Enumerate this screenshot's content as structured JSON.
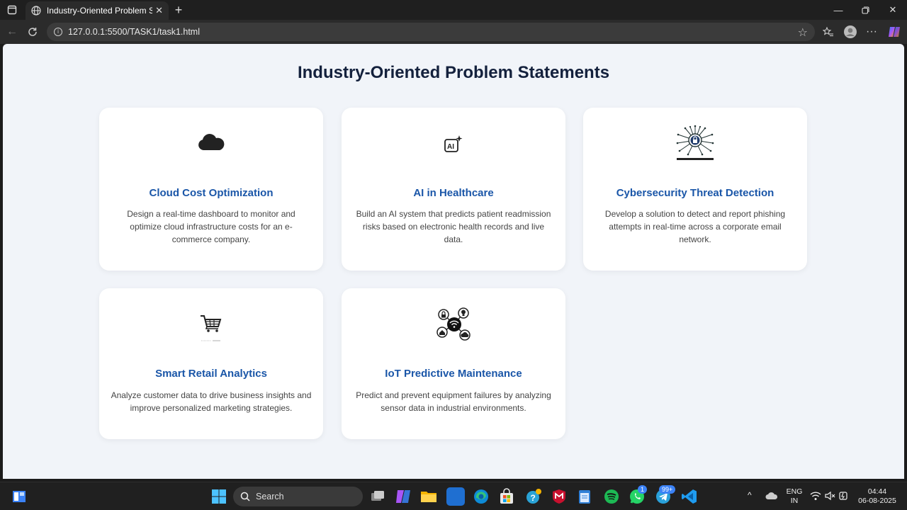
{
  "browser": {
    "tab_title": "Industry-Oriented Problem Staten",
    "url": "127.0.0.1:5500/TASK1/task1.html"
  },
  "page": {
    "title": "Industry-Oriented Problem Statements",
    "cards": [
      {
        "icon": "cloud-icon",
        "title": "Cloud Cost Optimization",
        "description": "Design a real-time dashboard to monitor and optimize cloud infrastructure costs for an e-commerce company."
      },
      {
        "icon": "ai-sparkle-icon",
        "title": "AI in Healthcare",
        "description": "Build an AI system that predicts patient readmission risks based on electronic health records and live data."
      },
      {
        "icon": "circuit-lock-icon",
        "title": "Cybersecurity Threat Detection",
        "description": "Develop a solution to detect and report phishing attempts in real-time across a corporate email network."
      },
      {
        "icon": "shopping-cart-icon",
        "title": "Smart Retail Analytics",
        "description": "Analyze customer data to drive business insights and improve personalized marketing strategies."
      },
      {
        "icon": "iot-network-icon",
        "title": "IoT Predictive Maintenance",
        "description": "Predict and prevent equipment failures by analyzing sensor data in industrial environments."
      }
    ]
  },
  "taskbar": {
    "search_label": "Search",
    "lang_line1": "ENG",
    "lang_line2": "IN",
    "time": "04:44",
    "date": "06-08-2025",
    "whatsapp_badge": "1",
    "telegram_badge": "99+"
  },
  "colors": {
    "card_title": "#1a56a8",
    "page_title": "#14213d",
    "page_bg": "#f1f4f9"
  }
}
